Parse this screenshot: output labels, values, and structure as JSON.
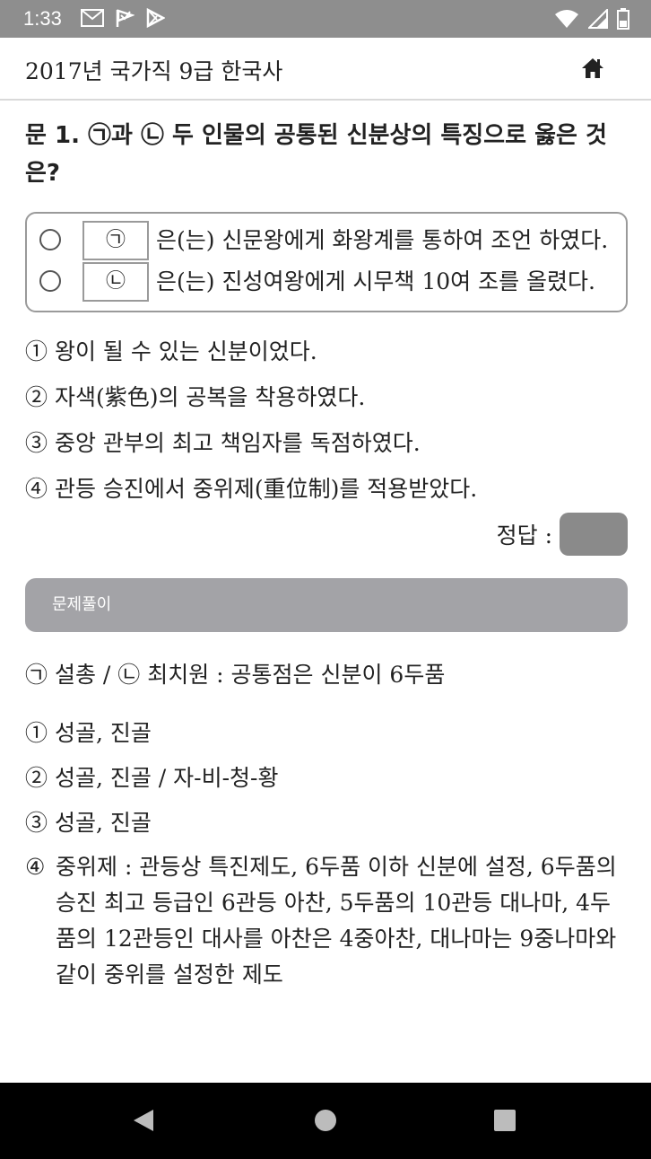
{
  "status": {
    "time": "1:33",
    "left_icons": [
      "gmail-icon",
      "flag-icon",
      "play-store-icon"
    ],
    "right_icons": [
      "wifi-icon",
      "signal-icon",
      "battery-icon"
    ]
  },
  "header": {
    "title": "2017년 국가직 9급 한국사",
    "home_icon": "home-icon"
  },
  "question": {
    "title": "문 1. ㉠과 ㉡ 두 인물의 공통된 신분상의 특징으로 옳은 것은?",
    "box": [
      {
        "label": "㉠",
        "text": "은(는) 신문왕에게 화왕계를 통하여 조언 하였다."
      },
      {
        "label": "㉡",
        "text": "은(는) 진성여왕에게 시무책 10여 조를 올렸다."
      }
    ],
    "options": [
      "① 왕이 될 수 있는 신분이었다.",
      "② 자색(紫色)의 공복을 착용하였다.",
      "③ 중앙 관부의 최고 책임자를 독점하였다.",
      "④ 관등 승진에서 중위제(重位制)를 적용받았다."
    ],
    "answer_label": "정답 :"
  },
  "explanation": {
    "header": "문제풀이",
    "summary": "㉠ 설총 / ㉡ 최치원 : 공통점은 신분이 6두품",
    "items": [
      "① 성골, 진골",
      "② 성골, 진골 / 자-비-청-황",
      "③ 성골, 진골"
    ],
    "item4_num": "④",
    "item4_text": "중위제 : 관등상 특진제도, 6두품 이하 신분에 설정, 6두품의 승진 최고 등급인 6관등 아찬, 5두품의 10관등 대나마, 4두품의 12관등인 대사를 아찬은 4중아찬, 대나마는 9중나마와 같이 중위를 설정한 제도"
  },
  "nav": {
    "back_icon": "back-icon",
    "home_icon": "home-circle-icon",
    "recent_icon": "recents-icon"
  }
}
